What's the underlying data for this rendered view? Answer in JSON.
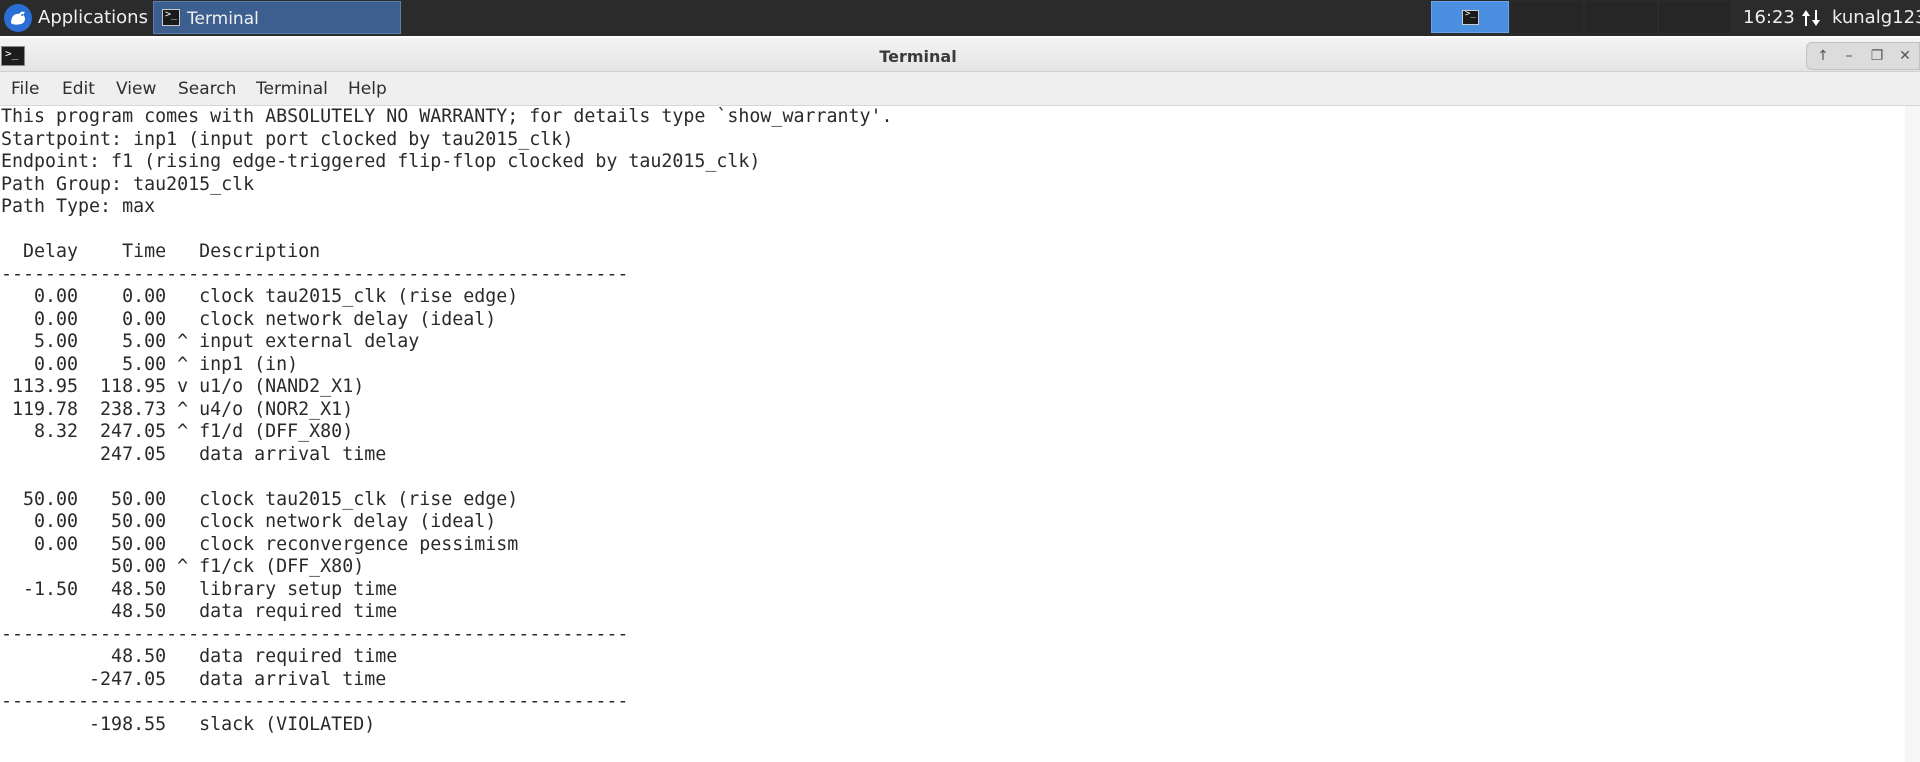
{
  "panel": {
    "applications_label": "Applications",
    "task_terminal_label": "Terminal",
    "clock": "16:23",
    "user": "kunalg123",
    "icons": {
      "applications": "xfce-mouse-logo-icon",
      "task_terminal": "terminal-icon",
      "workspace": "terminal-icon",
      "network": "network-updown-icon"
    }
  },
  "window": {
    "title": "Terminal",
    "controls": {
      "up": "↑",
      "minimize": "–",
      "maximize": "❐",
      "close": "✕"
    }
  },
  "menubar": {
    "items": [
      "File",
      "Edit",
      "View",
      "Search",
      "Terminal",
      "Help"
    ]
  },
  "terminal": {
    "output": "This program comes with ABSOLUTELY NO WARRANTY; for details type `show_warranty'.\nStartpoint: inp1 (input port clocked by tau2015_clk)\nEndpoint: f1 (rising edge-triggered flip-flop clocked by tau2015_clk)\nPath Group: tau2015_clk\nPath Type: max\n\n  Delay    Time   Description\n---------------------------------------------------------\n   0.00    0.00   clock tau2015_clk (rise edge)\n   0.00    0.00   clock network delay (ideal)\n   5.00    5.00 ^ input external delay\n   0.00    5.00 ^ inp1 (in)\n 113.95  118.95 v u1/o (NAND2_X1)\n 119.78  238.73 ^ u4/o (NOR2_X1)\n   8.32  247.05 ^ f1/d (DFF_X80)\n         247.05   data arrival time\n\n  50.00   50.00   clock tau2015_clk (rise edge)\n   0.00   50.00   clock network delay (ideal)\n   0.00   50.00   clock reconvergence pessimism\n          50.00 ^ f1/ck (DFF_X80)\n  -1.50   48.50   library setup time\n          48.50   data required time\n---------------------------------------------------------\n          48.50   data required time\n        -247.05   data arrival time\n---------------------------------------------------------\n        -198.55   slack (VIOLATED)"
  },
  "colors": {
    "panel_bg": "#2b2b2b",
    "task_active": "#3c5f8f",
    "workspace_active": "#4a8fe0",
    "terminal_bg": "#ffffff",
    "terminal_fg": "#2a2a2a"
  }
}
